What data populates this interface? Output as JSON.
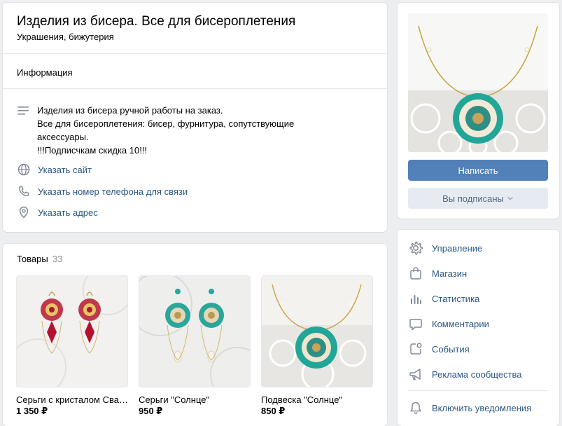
{
  "community": {
    "title": "Изделия из бисера. Все для бисероплетения",
    "category": "Украшения, бижутерия"
  },
  "info": {
    "section_label": "Информация",
    "description_lines": [
      "Изделия из бисера ручной работы на заказ.",
      "Все для бисероплетения: бисер, фурнитура, сопутствующие",
      "аксессуары.",
      "!!!Подписчкам скидка 10!!!"
    ],
    "links": {
      "site": "Указать сайт",
      "phone": "Указать номер телефона для связи",
      "address": "Указать адрес"
    }
  },
  "products": {
    "label": "Товары",
    "count": "33",
    "items": [
      {
        "name": "Серьги с кристалом Сваровски",
        "price": "1 350 ₽"
      },
      {
        "name": "Серьги \"Солнце\"",
        "price": "950 ₽"
      },
      {
        "name": "Подвеска \"Солнце\"",
        "price": "850 ₽"
      }
    ]
  },
  "actions": {
    "write": "Написать",
    "subscribed": "Вы подписаны"
  },
  "menu": {
    "manage": "Управление",
    "shop": "Магазин",
    "stats": "Статистика",
    "comments": "Комментарии",
    "events": "События",
    "ads": "Реклама сообщества",
    "notify": "Включить уведомления"
  },
  "colors": {
    "background": "#edeef0",
    "link": "#2a5885",
    "primary_button": "#5181b8",
    "secondary_button": "#e5ebf1",
    "icon": "#828a99"
  }
}
